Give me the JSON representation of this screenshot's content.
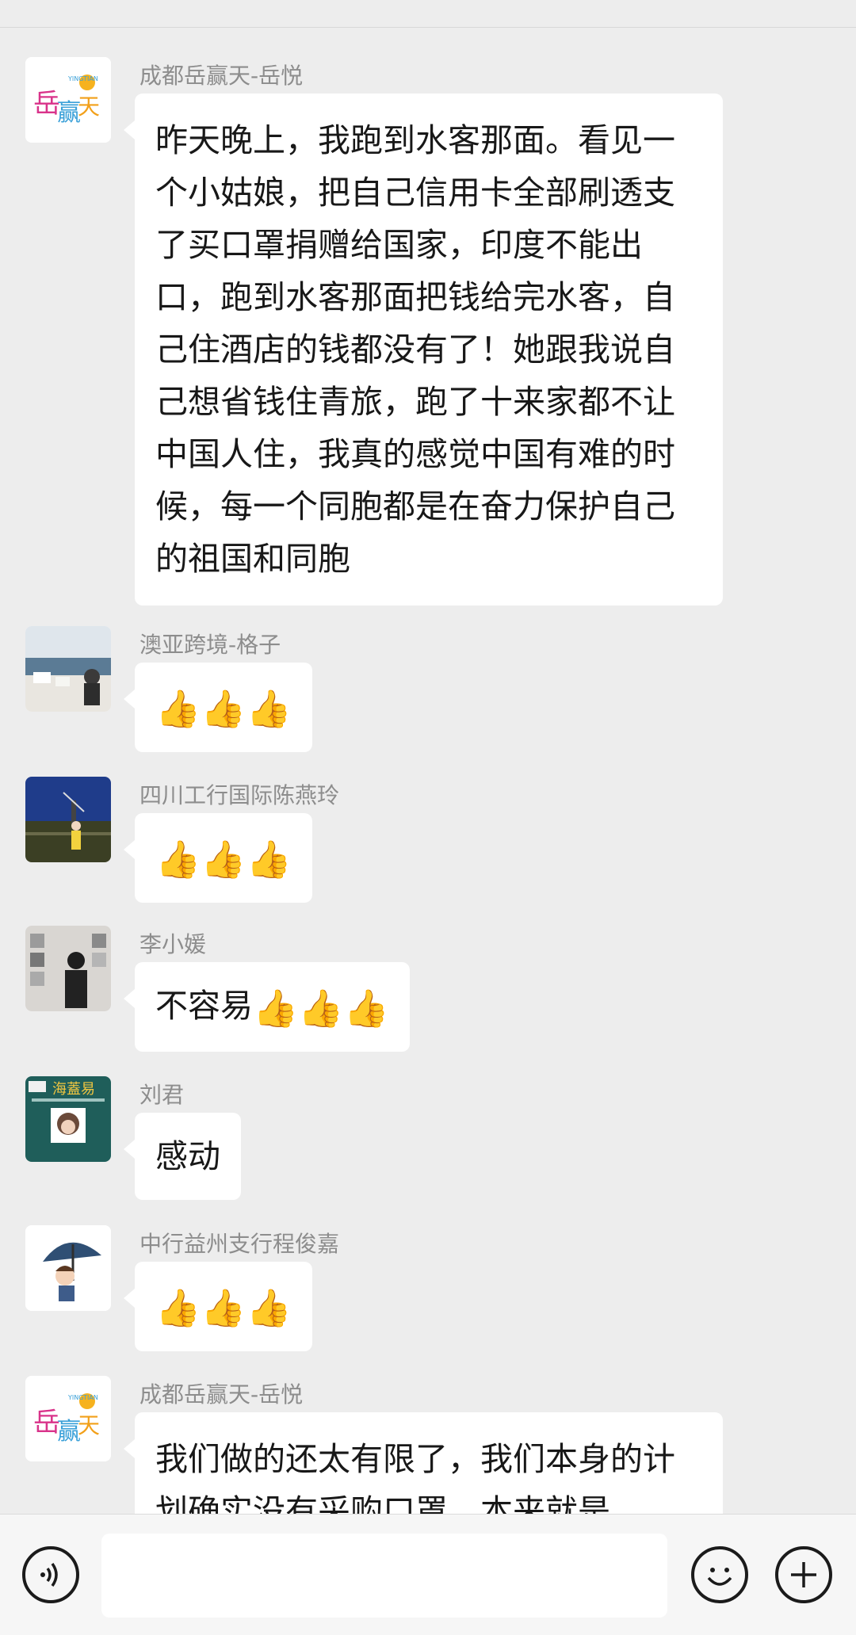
{
  "messages": [
    {
      "name": "成都岳赢天-岳悦",
      "avatar": "yueyingtian-logo",
      "text": "昨天晚上，我跑到水客那面。看见一个小姑娘，把自己信用卡全部刷透支了买口罩捐赠给国家，印度不能出口，跑到水客那面把钱给完水客，自己住酒店的钱都没有了！她跟我说自己想省钱住青旅，跑了十来家都不让中国人住，我真的感觉中国有难的时候，每一个同胞都是在奋力保护自己的祖国和同胞"
    },
    {
      "name": "澳亚跨境-格子",
      "avatar": "seaside-photo",
      "text": "",
      "emoji": "👍👍👍"
    },
    {
      "name": "四川工行国际陈燕玲",
      "avatar": "windmill-photo",
      "text": "",
      "emoji": "👍👍👍"
    },
    {
      "name": "李小媛",
      "avatar": "portrait-photo",
      "text": "不容易",
      "emoji": "👍👍👍"
    },
    {
      "name": "刘君",
      "avatar": "haimaiyi-logo",
      "text": "感动",
      "emoji": ""
    },
    {
      "name": "中行益州支行程俊嘉",
      "avatar": "umbrella-cartoon",
      "text": "",
      "emoji": "👍👍👍"
    },
    {
      "name": "成都岳赢天-岳悦",
      "avatar": "yueyingtian-logo",
      "text": "我们做的还太有限了，我们本身的计划确实没有采购口罩，本来就是"
    }
  ],
  "logo_text": "YINGTIAN",
  "haimaiyi_text": "海蓋易",
  "icons": {
    "voice": "voice-icon",
    "emoji": "emoji-icon",
    "plus": "plus-icon"
  },
  "colors": {
    "background": "#ededed",
    "bubble": "#ffffff",
    "name": "#8d8d8d"
  }
}
